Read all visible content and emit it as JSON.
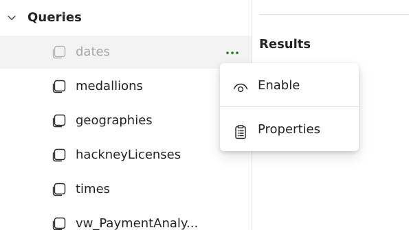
{
  "queries_section": {
    "label": "Queries",
    "items": [
      {
        "label": "dates"
      },
      {
        "label": "medallions"
      },
      {
        "label": "geographies"
      },
      {
        "label": "hackneyLicenses"
      },
      {
        "label": "times"
      },
      {
        "label": "vw_PaymentAnaly..."
      }
    ]
  },
  "results": {
    "title": "Results"
  },
  "context_menu": {
    "items": [
      {
        "label": "Enable",
        "icon": "eye-icon"
      },
      {
        "label": "Properties",
        "icon": "clipboard-icon"
      }
    ]
  },
  "colors": {
    "selected_row_bg": "#f3f3f3",
    "more_button_dots": "#107c10",
    "disabled_text": "#a7a7a7",
    "text": "#242424"
  }
}
